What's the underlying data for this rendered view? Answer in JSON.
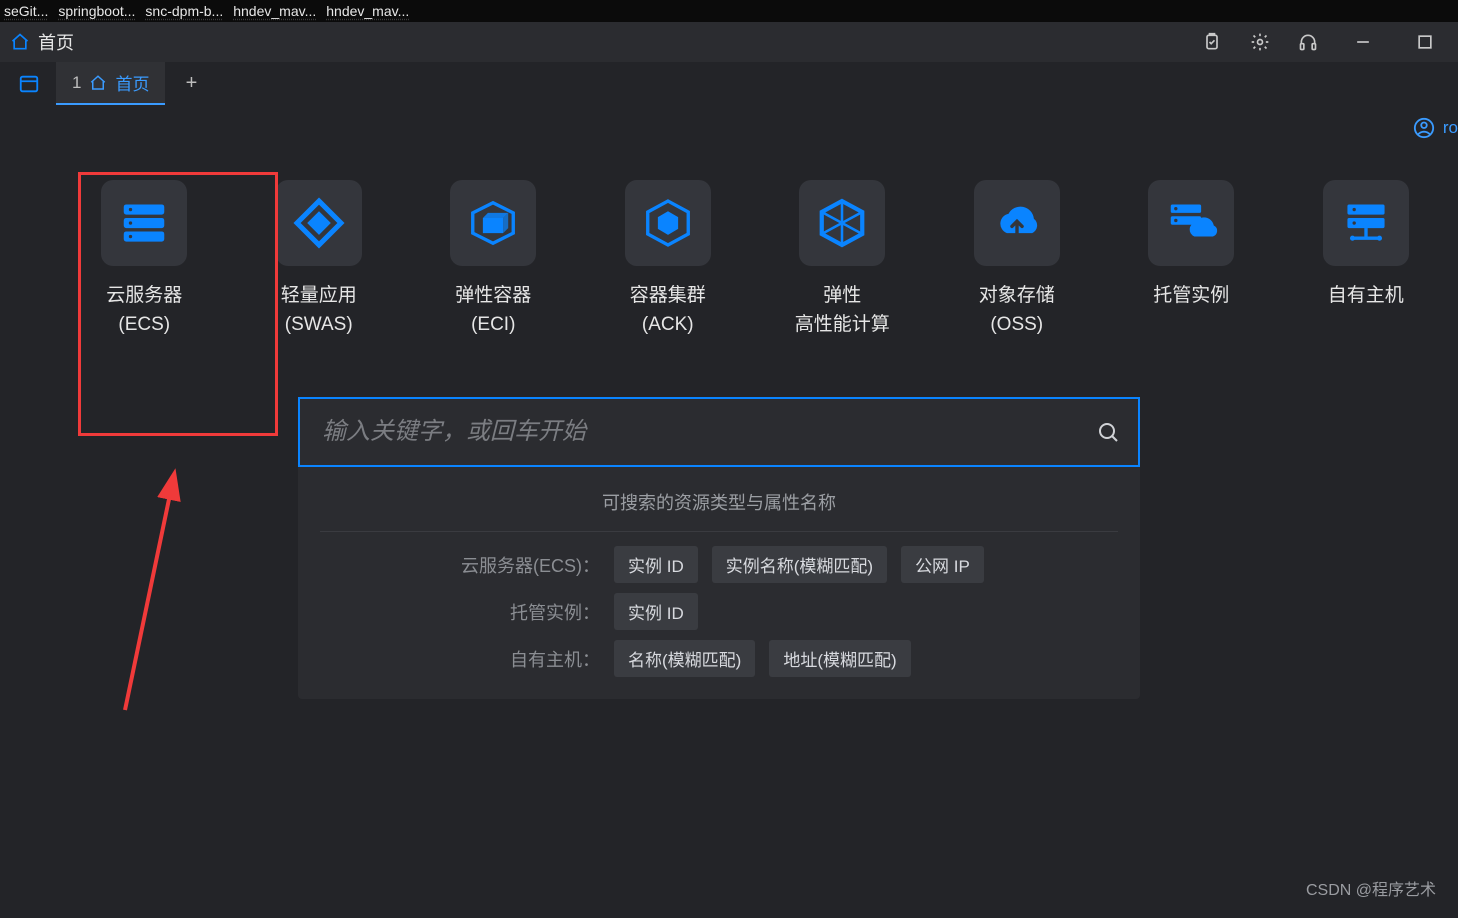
{
  "colors": {
    "accent": "#0a84ff",
    "highlight_border": "#f03a3a"
  },
  "top_black_tabs": [
    "seGit...",
    "springboot...",
    "snc-dpm-b...",
    "hndev_mav...",
    "hndev_mav..."
  ],
  "title_bar": {
    "home_label": "首页"
  },
  "tab_strip": {
    "active_number": "1",
    "active_label": "首页"
  },
  "user": {
    "name": "ro"
  },
  "tiles": [
    {
      "icon": "server-icon",
      "line1": "云服务器",
      "line2": "(ECS)"
    },
    {
      "icon": "diamond-icon",
      "line1": "轻量应用",
      "line2": "(SWAS)"
    },
    {
      "icon": "cube-icon",
      "line1": "弹性容器",
      "line2": "(ECI)"
    },
    {
      "icon": "cluster-icon",
      "line1": "容器集群",
      "line2": "(ACK)"
    },
    {
      "icon": "hex-icon",
      "line1": "弹性",
      "line2": "高性能计算"
    },
    {
      "icon": "cloud-up-icon",
      "line1": "对象存储",
      "line2": "(OSS)"
    },
    {
      "icon": "host-cloud-icon",
      "line1": "托管实例",
      "line2": ""
    },
    {
      "icon": "rack-icon",
      "line1": "自有主机",
      "line2": ""
    }
  ],
  "search": {
    "placeholder": "输入关键字，或回车开始"
  },
  "search_panel": {
    "title": "可搜索的资源类型与属性名称",
    "rows": [
      {
        "key": "云服务器(ECS)：",
        "chips": [
          "实例 ID",
          "实例名称(模糊匹配)",
          "公网 IP"
        ]
      },
      {
        "key": "托管实例：",
        "chips": [
          "实例 ID"
        ]
      },
      {
        "key": "自有主机：",
        "chips": [
          "名称(模糊匹配)",
          "地址(模糊匹配)"
        ]
      }
    ]
  },
  "watermark": "CSDN @程序艺术"
}
